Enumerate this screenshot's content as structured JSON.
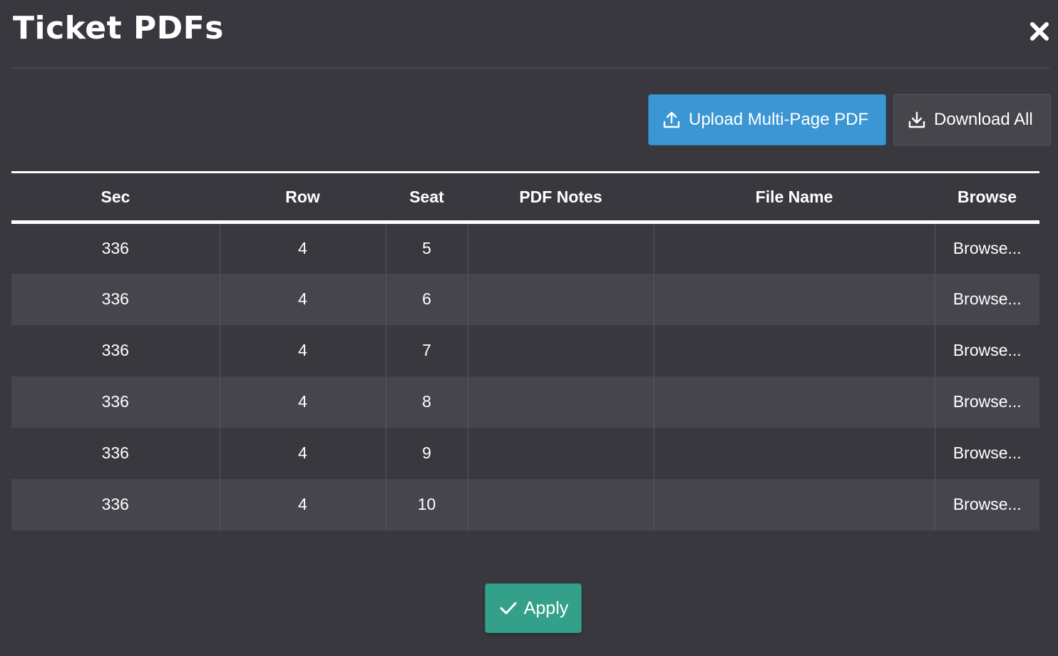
{
  "modal": {
    "title": "Ticket PDFs",
    "close_icon": "close-icon"
  },
  "toolbar": {
    "upload_label": "Upload Multi-Page PDF",
    "upload_icon": "upload-icon",
    "download_label": "Download All",
    "download_icon": "download-icon"
  },
  "table": {
    "columns": [
      "Sec",
      "Row",
      "Seat",
      "PDF Notes",
      "File Name",
      "Browse"
    ],
    "rows": [
      {
        "sec": "336",
        "row": "4",
        "seat": "5",
        "notes": "",
        "file_name": "",
        "browse": "Browse..."
      },
      {
        "sec": "336",
        "row": "4",
        "seat": "6",
        "notes": "",
        "file_name": "",
        "browse": "Browse..."
      },
      {
        "sec": "336",
        "row": "4",
        "seat": "7",
        "notes": "",
        "file_name": "",
        "browse": "Browse..."
      },
      {
        "sec": "336",
        "row": "4",
        "seat": "8",
        "notes": "",
        "file_name": "",
        "browse": "Browse..."
      },
      {
        "sec": "336",
        "row": "4",
        "seat": "9",
        "notes": "",
        "file_name": "",
        "browse": "Browse..."
      },
      {
        "sec": "336",
        "row": "4",
        "seat": "10",
        "notes": "",
        "file_name": "",
        "browse": "Browse..."
      }
    ]
  },
  "footer": {
    "apply_label": "Apply",
    "apply_icon": "check-icon"
  },
  "colors": {
    "background": "#39383e",
    "row_alt": "#46454d",
    "upload_button": "#3b96d3",
    "download_button": "#46454b",
    "apply_button": "#35a089"
  }
}
